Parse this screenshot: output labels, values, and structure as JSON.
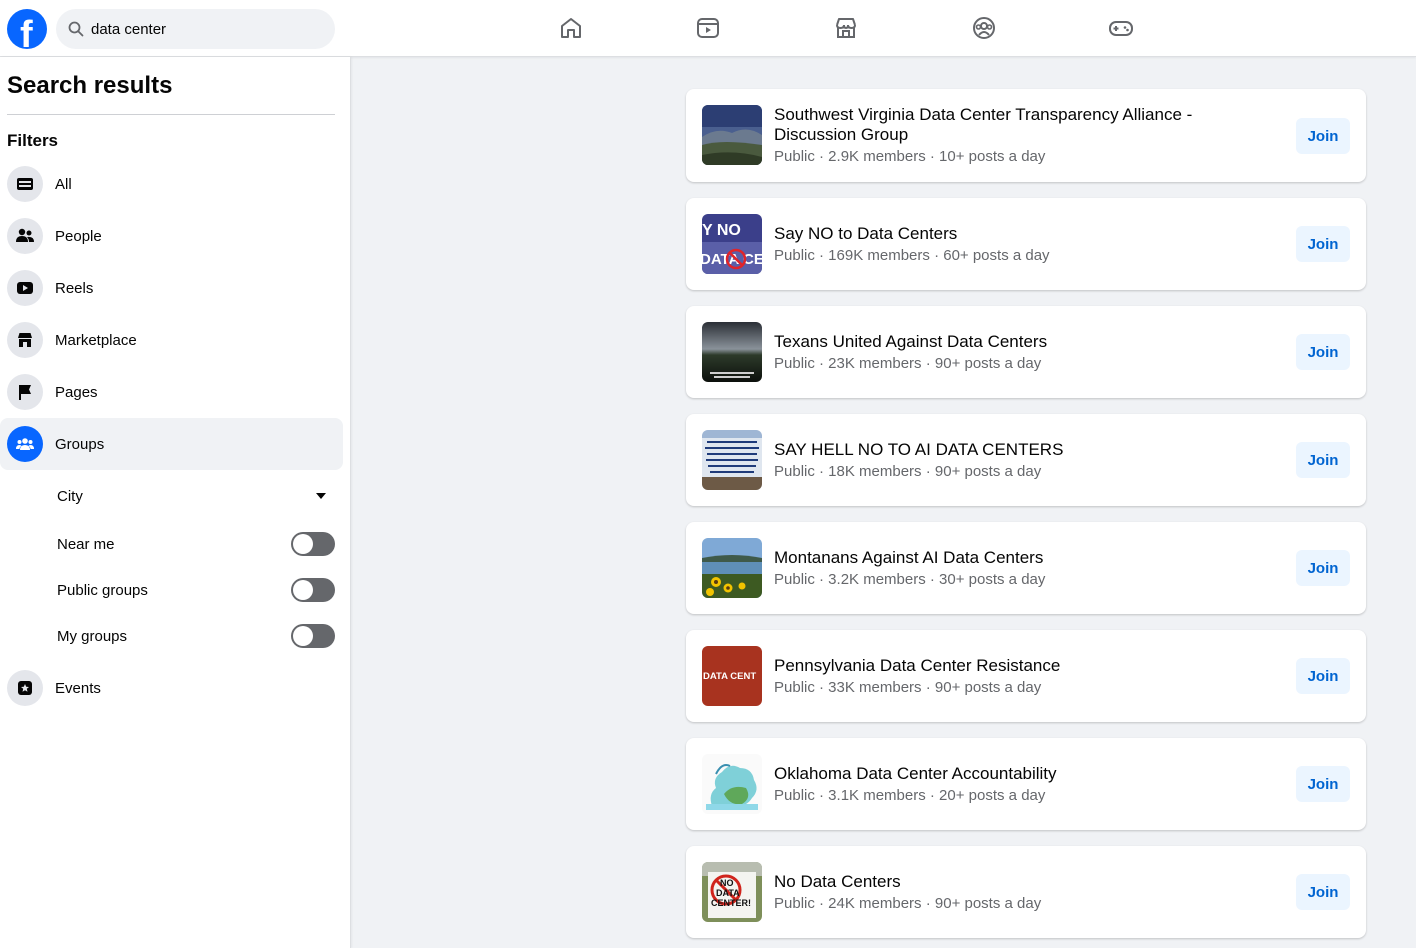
{
  "header": {
    "logo_letter": "f",
    "search": {
      "value": "data center",
      "placeholder": "Search Facebook"
    },
    "nav": [
      {
        "icon": "home-icon"
      },
      {
        "icon": "video-icon"
      },
      {
        "icon": "marketplace-icon"
      },
      {
        "icon": "groups-icon"
      },
      {
        "icon": "gaming-icon"
      }
    ]
  },
  "sidebar": {
    "title": "Search results",
    "filters_heading": "Filters",
    "items": [
      {
        "label": "All",
        "icon": "all-icon"
      },
      {
        "label": "People",
        "icon": "people-icon"
      },
      {
        "label": "Reels",
        "icon": "reels-icon"
      },
      {
        "label": "Marketplace",
        "icon": "marketplace-icon"
      },
      {
        "label": "Pages",
        "icon": "flag-icon"
      },
      {
        "label": "Groups",
        "icon": "groups-icon",
        "active": true
      },
      {
        "label": "Events",
        "icon": "events-icon"
      }
    ],
    "group_filters": {
      "city": "City",
      "near_me": "Near me",
      "public_groups": "Public groups",
      "my_groups": "My groups"
    }
  },
  "results": [
    {
      "title": "Southwest Virginia Data Center Transparency Alliance - Discussion Group",
      "meta": "Public · 2.9K members · 10+ posts a day",
      "join": "Join"
    },
    {
      "title": "Say NO to Data Centers",
      "meta": "Public · 169K members · 60+ posts a day",
      "join": "Join",
      "thumb_text_1": "Y NO",
      "thumb_text_2": "DATA CEN"
    },
    {
      "title": "Texans United Against Data Centers",
      "meta": "Public · 23K members · 90+ posts a day",
      "join": "Join"
    },
    {
      "title": "SAY HELL NO TO AI DATA CENTERS",
      "meta": "Public · 18K members · 90+ posts a day",
      "join": "Join"
    },
    {
      "title": "Montanans Against AI Data Centers",
      "meta": "Public · 3.2K members · 30+ posts a day",
      "join": "Join"
    },
    {
      "title": "Pennsylvania Data Center Resistance",
      "meta": "Public · 33K members · 90+ posts a day",
      "join": "Join",
      "thumb_text": "DATA CENT"
    },
    {
      "title": "Oklahoma Data Center Accountability",
      "meta": "Public · 3.1K members · 20+ posts a day",
      "join": "Join"
    },
    {
      "title": "No Data Centers",
      "meta": "Public · 24K members · 90+ posts a day",
      "join": "Join",
      "thumb_text_1": "NO",
      "thumb_text_2": "DATA",
      "thumb_text_3": "CENTER!"
    }
  ],
  "colors": {
    "accent": "#0866ff",
    "join_bg": "#ebf5ff",
    "join_text": "#0064d1"
  }
}
